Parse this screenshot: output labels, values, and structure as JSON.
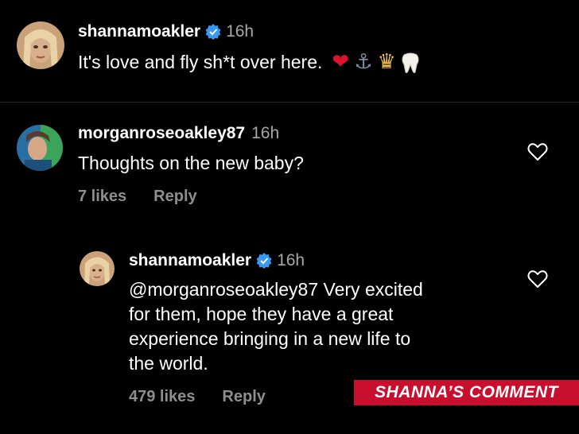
{
  "comment1": {
    "username": "shannamoakler",
    "time": "16h",
    "text": "It's love and fly sh*t over here.",
    "emojis": [
      "heart-emoji",
      "anchor-emoji",
      "princess-emoji",
      "tooth-emoji"
    ]
  },
  "comment2": {
    "username": "morganroseoakley87",
    "time": "16h",
    "text": "Thoughts on the new baby?",
    "likes": "7 likes",
    "reply": "Reply"
  },
  "reply1": {
    "username": "shannamoakler",
    "time": "16h",
    "text_lines": [
      "@morganroseoakley87 Very excited",
      "for them, hope they have a great",
      "experience bringing in a new life to",
      "the world."
    ],
    "likes": "479 likes",
    "reply": "Reply"
  },
  "banner": {
    "text": "SHANNA’S COMMENT"
  },
  "colors": {
    "background": "#000000",
    "verified": "#3897f0",
    "meta": "#8e8e8e",
    "banner": "#c8102e"
  }
}
